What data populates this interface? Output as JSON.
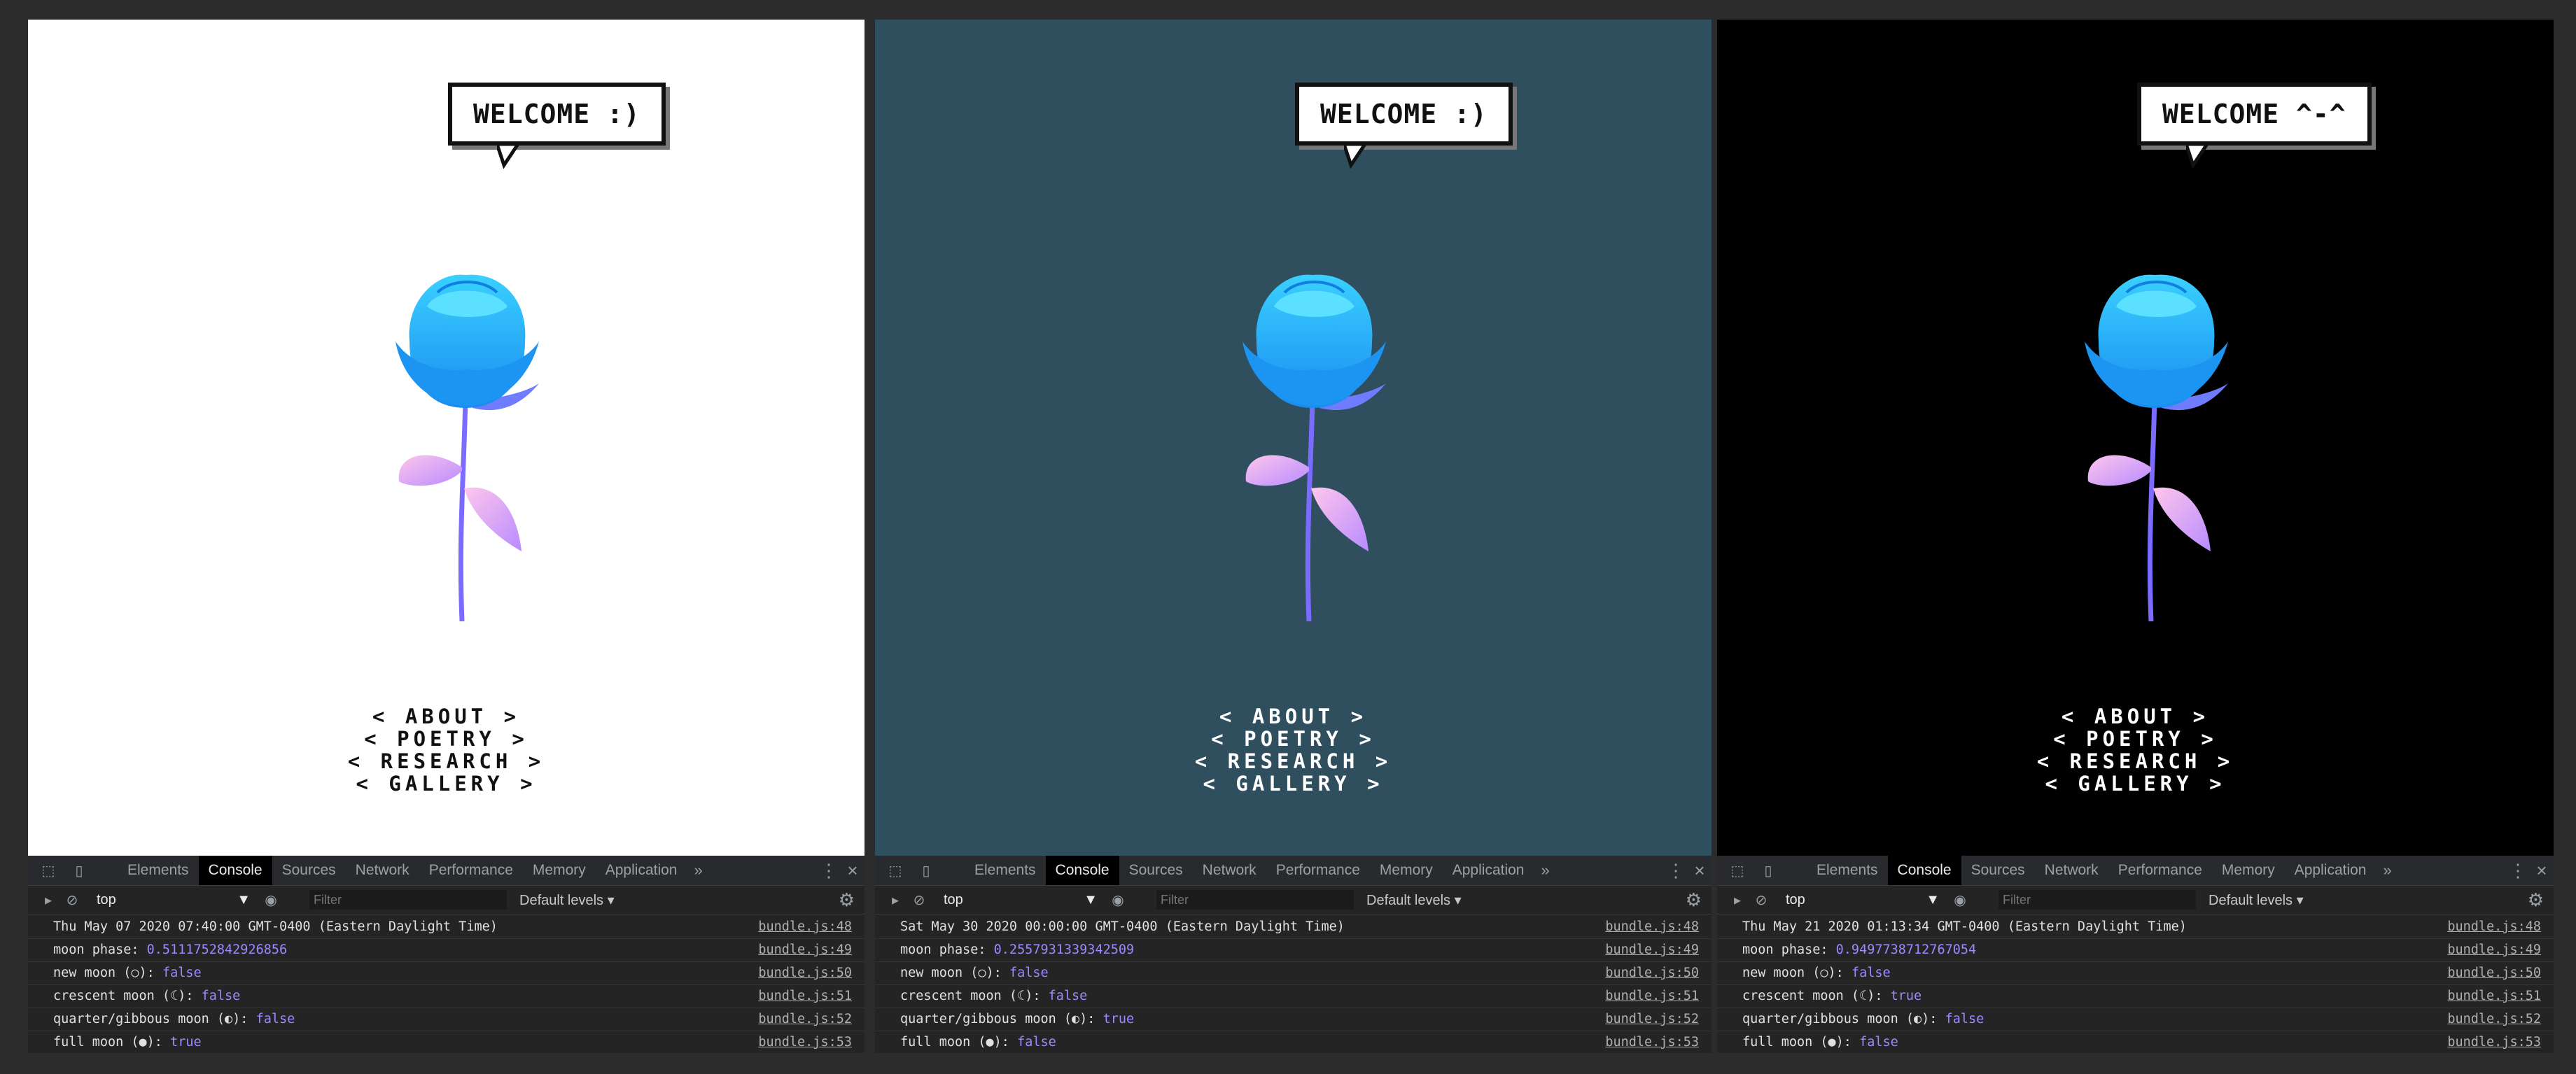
{
  "panels": [
    {
      "id": "white",
      "bg": "#ffffff",
      "text_color": "#111111",
      "welcome": "WELCOME :)",
      "nav": [
        "< ABOUT >",
        "< POETRY >",
        "< RESEARCH >",
        "< GALLERY >"
      ],
      "devtools": {
        "tabs": [
          "Elements",
          "Console",
          "Sources",
          "Network",
          "Performance",
          "Memory",
          "Application"
        ],
        "active_tab": "Console",
        "more_tabs": "»",
        "context": "top",
        "filter_placeholder": "Filter",
        "levels": "Default levels ▾",
        "logs": [
          {
            "msg": "Thu May 07 2020 07:40:00 GMT-0400 (Eastern Daylight Time)",
            "val": "",
            "src": "bundle.js:48"
          },
          {
            "msg": "moon phase: ",
            "val": "0.5111752842926856",
            "src": "bundle.js:49"
          },
          {
            "msg": "new moon (○): ",
            "val": "false",
            "src": "bundle.js:50"
          },
          {
            "msg": "crescent moon (☾): ",
            "val": "false",
            "src": "bundle.js:51"
          },
          {
            "msg": "quarter/gibbous moon (◐): ",
            "val": "false",
            "src": "bundle.js:52"
          },
          {
            "msg": "full moon (●): ",
            "val": "true",
            "src": "bundle.js:53"
          }
        ]
      }
    },
    {
      "id": "teal",
      "bg": "#2f4f5f",
      "text_color": "#ffffff",
      "welcome": "WELCOME :)",
      "nav": [
        "< ABOUT >",
        "< POETRY >",
        "< RESEARCH >",
        "< GALLERY >"
      ],
      "devtools": {
        "tabs": [
          "Elements",
          "Console",
          "Sources",
          "Network",
          "Performance",
          "Memory",
          "Application"
        ],
        "active_tab": "Console",
        "more_tabs": "»",
        "context": "top",
        "filter_placeholder": "Filter",
        "levels": "Default levels ▾",
        "logs": [
          {
            "msg": "Sat May 30 2020 00:00:00 GMT-0400 (Eastern Daylight Time)",
            "val": "",
            "src": "bundle.js:48"
          },
          {
            "msg": "moon phase: ",
            "val": "0.2557931339342509",
            "src": "bundle.js:49"
          },
          {
            "msg": "new moon (○): ",
            "val": "false",
            "src": "bundle.js:50"
          },
          {
            "msg": "crescent moon (☾): ",
            "val": "false",
            "src": "bundle.js:51"
          },
          {
            "msg": "quarter/gibbous moon (◐): ",
            "val": "true",
            "src": "bundle.js:52"
          },
          {
            "msg": "full moon (●): ",
            "val": "false",
            "src": "bundle.js:53"
          }
        ]
      }
    },
    {
      "id": "black",
      "bg": "#000000",
      "text_color": "#ffffff",
      "welcome": "WELCOME ^-^",
      "nav": [
        "< ABOUT >",
        "< POETRY >",
        "< RESEARCH >",
        "< GALLERY >"
      ],
      "devtools": {
        "tabs": [
          "Elements",
          "Console",
          "Sources",
          "Network",
          "Performance",
          "Memory",
          "Application"
        ],
        "active_tab": "Console",
        "more_tabs": "»",
        "context": "top",
        "filter_placeholder": "Filter",
        "levels": "Default levels ▾",
        "logs": [
          {
            "msg": "Thu May 21 2020 01:13:34 GMT-0400 (Eastern Daylight Time)",
            "val": "",
            "src": "bundle.js:48"
          },
          {
            "msg": "moon phase: ",
            "val": "0.9497738712767054",
            "src": "bundle.js:49"
          },
          {
            "msg": "new moon (○): ",
            "val": "false",
            "src": "bundle.js:50"
          },
          {
            "msg": "crescent moon (☾): ",
            "val": "true",
            "src": "bundle.js:51"
          },
          {
            "msg": "quarter/gibbous moon (◐): ",
            "val": "false",
            "src": "bundle.js:52"
          },
          {
            "msg": "full moon (●): ",
            "val": "false",
            "src": "bundle.js:53"
          }
        ]
      }
    }
  ]
}
